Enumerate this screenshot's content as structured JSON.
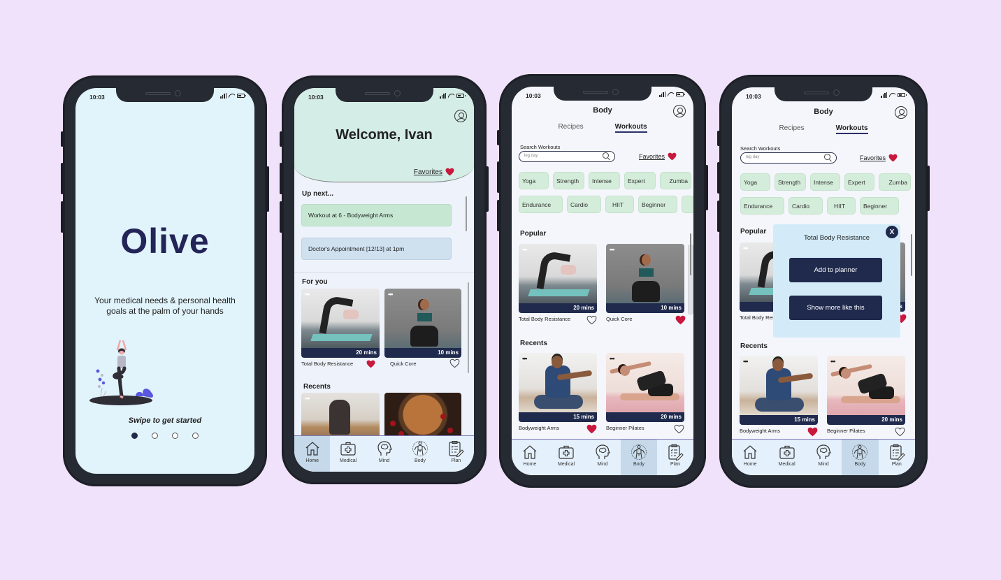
{
  "status_bar": {
    "time": "10:03"
  },
  "icons": {
    "heart_filled": "heart-filled-icon",
    "heart_outline": "heart-outline-icon",
    "profile": "profile-icon",
    "search": "search-icon"
  },
  "colors": {
    "background": "#f0e2fa",
    "brand_navy": "#232457",
    "accent_navy": "#1f2a4d",
    "favorite_red": "#c8193c",
    "chip_green": "#d4ecda",
    "header_mint": "#d4ede6",
    "nav_bg": "#e4f0fb",
    "nav_active": "#c5d9ea"
  },
  "onboarding": {
    "logo": "Olive",
    "tagline": "Your medical needs & personal health goals at the palm of your hands",
    "swipe_text": "Swipe to get started",
    "pages_total": 4,
    "page_current": 1
  },
  "home": {
    "welcome": "Welcome, Ivan",
    "favorites_label": "Favorites",
    "up_next_title": "Up next...",
    "up_next": [
      {
        "label": "Workout at 6 - Bodyweight Arms",
        "color": "#c6e8d2"
      },
      {
        "label": "Doctor's Appointment [12/13] at 1pm",
        "color": "#cfe0ef"
      }
    ],
    "for_you_title": "For you",
    "for_you": [
      {
        "title": "Total Body Resistance",
        "duration": "20 mins",
        "favorited": true
      },
      {
        "title": "Quick Core",
        "duration": "10 mins",
        "favorited": false
      }
    ],
    "recents_title": "Recents",
    "more_label": "•••"
  },
  "body": {
    "title": "Body",
    "tabs": [
      {
        "label": "Recipes",
        "active": false
      },
      {
        "label": "Workouts",
        "active": true
      }
    ],
    "search_label": "Search Workouts",
    "search_placeholder": "leg day",
    "favorites_label": "Favorites",
    "chips_row1": [
      "Yoga",
      "Strength",
      "Intense",
      "Expert",
      "Zumba"
    ],
    "chips_row2": [
      "Endurance",
      "Cardio",
      "HIIT",
      "Beginner"
    ],
    "popular_title": "Popular",
    "recents_title": "Recents",
    "more_label": "•••",
    "popular": [
      {
        "title": "Total Body Resistance",
        "duration": "20 mins",
        "favorited": false
      },
      {
        "title": "Quick Core",
        "duration": "10 mins",
        "favorited": true
      }
    ],
    "recents": [
      {
        "title": "Bodyweight Arms",
        "duration": "15 mins",
        "favorited": true
      },
      {
        "title": "Beginner Pilates",
        "duration": "20 mins",
        "favorited": false
      }
    ]
  },
  "popup": {
    "title": "Total Body Resistance",
    "add_label": "Add to planner",
    "more_label": "Show more like this",
    "close_label": "X"
  },
  "nav": [
    {
      "label": "Home",
      "icon": "home-icon"
    },
    {
      "label": "Medical",
      "icon": "medical-kit-icon"
    },
    {
      "label": "Mind",
      "icon": "brain-icon"
    },
    {
      "label": "Body",
      "icon": "body-icon"
    },
    {
      "label": "Plan",
      "icon": "clipboard-icon"
    }
  ]
}
